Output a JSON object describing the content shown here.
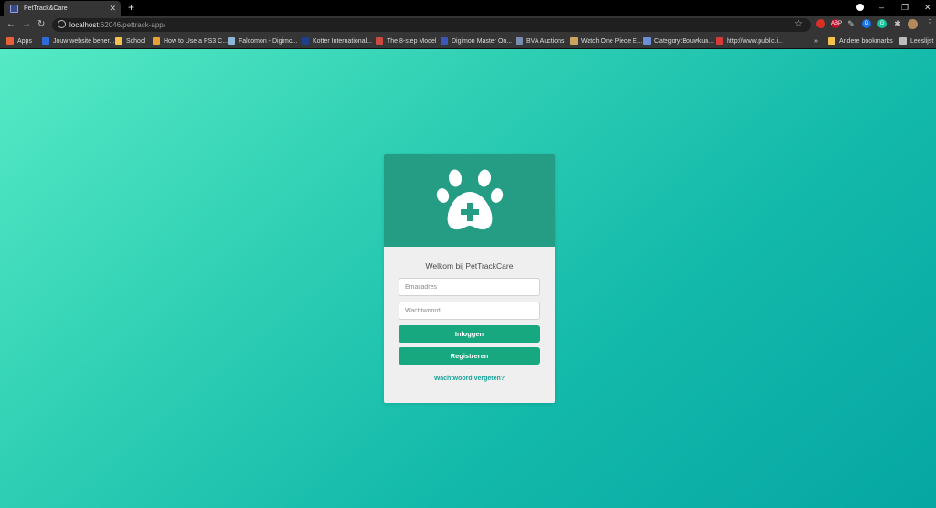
{
  "browser": {
    "tab": {
      "title": "PetTrack&Care"
    },
    "address": {
      "host": "localhost",
      "rest": ":62046/pettrack-app/"
    },
    "extensions": [
      {
        "name": "record-icon",
        "color": "#d93025",
        "label": ""
      },
      {
        "name": "abp-icon",
        "color": "#c70d2c",
        "label": "ABP"
      },
      {
        "name": "pin-icon",
        "color": "#353535",
        "label": ""
      },
      {
        "name": "google-icon",
        "color": "#1a73e8",
        "label": "G"
      },
      {
        "name": "grammarly-icon",
        "color": "#15c39a",
        "label": "G"
      },
      {
        "name": "puzzle-icon",
        "color": "#353535",
        "label": ""
      }
    ],
    "bookmarks": [
      {
        "label": "Apps",
        "color": "#e6603a"
      },
      {
        "label": "Jouw website beher...",
        "color": "#2d6bd6"
      },
      {
        "label": "School",
        "color": "#f2c14e"
      },
      {
        "label": "How to Use a PS3 C...",
        "color": "#e5a23a"
      },
      {
        "label": "Falcomon - Digimo...",
        "color": "#8fb6d8"
      },
      {
        "label": "Kotter International...",
        "color": "#1e3f8a"
      },
      {
        "label": "The 8-step Model",
        "color": "#c94a3e"
      },
      {
        "label": "Digimon Master On...",
        "color": "#3956b8"
      },
      {
        "label": "BVA Auctions",
        "color": "#7a8cb0"
      },
      {
        "label": "Watch One Piece E...",
        "color": "#cfa35f"
      },
      {
        "label": "Category:Bouwkun...",
        "color": "#6c8fd6"
      },
      {
        "label": "http://www.public.i...",
        "color": "#d83a3a"
      }
    ],
    "bookmarks_overflow": "»",
    "other_bookmarks": "Andere bookmarks",
    "reading_list": "Leeslijst"
  },
  "login": {
    "brand_color": "#259d85",
    "accent_color": "#17a880",
    "logo_icon": "paw-plus-icon",
    "welcome": "Welkom bij PetTrackCare",
    "email_placeholder": "Emailadres",
    "password_placeholder": "Wachtwoord",
    "login_button": "Inloggen",
    "register_button": "Registreren",
    "forgot_link": "Wachtwoord vergeten?"
  }
}
